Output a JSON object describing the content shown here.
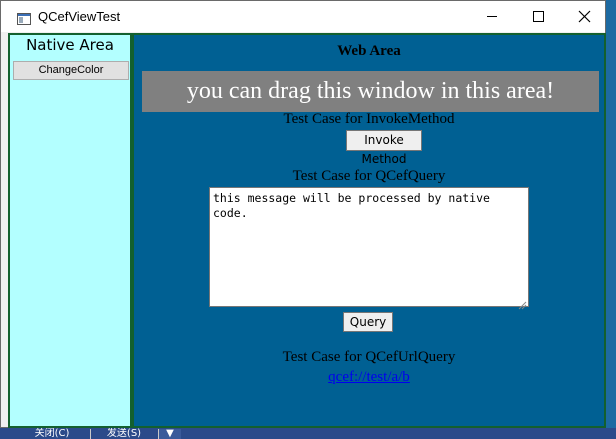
{
  "window": {
    "title": "QCefViewTest"
  },
  "native_area": {
    "title": "Native Area",
    "change_color_label": "ChangeColor"
  },
  "web_area": {
    "title": "Web Area",
    "drag_text": "you can drag this window in this area!",
    "invoke_case_label": "Test Case for InvokeMethod",
    "invoke_button_label": "Invoke Method",
    "query_case_label": "Test Case for QCefQuery",
    "query_text": "this message will be processed by native code.",
    "query_button_label": "Query",
    "url_case_label": "Test Case for QCefUrlQuery",
    "url_link_text": "qcef://test/a/b"
  },
  "background": {
    "buttons": [
      "关闭(C)",
      "发送(S)",
      "▼"
    ]
  },
  "colors": {
    "native_bg": "#b3ffff",
    "web_bg": "#006093",
    "drag_bg": "#808080",
    "frame_border": "#13602e"
  },
  "icons": [
    "app-icon",
    "minimize-icon",
    "maximize-icon",
    "close-icon",
    "resize-grip-icon"
  ]
}
